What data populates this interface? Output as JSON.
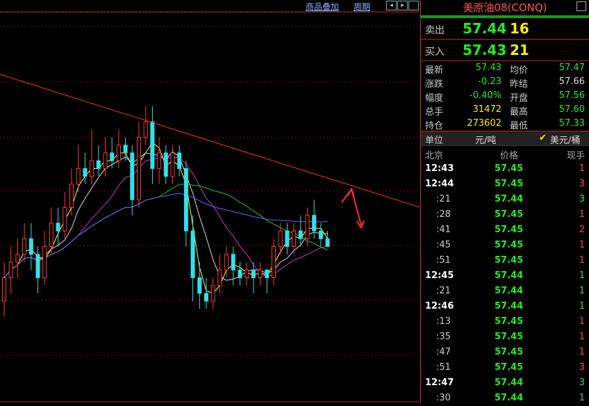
{
  "topbar": {
    "overlay_label": "商品叠加",
    "period_label": "周期",
    "nav_left_icon": "◂",
    "nav_right_icon": "▸"
  },
  "chart_data": {
    "type": "candlestick",
    "title": "",
    "candles": [
      {
        "o": 57.35,
        "c": 57.38,
        "h": 57.4,
        "l": 57.33
      },
      {
        "o": 57.38,
        "c": 57.4,
        "h": 57.42,
        "l": 57.36
      },
      {
        "o": 57.4,
        "c": 57.41,
        "h": 57.43,
        "l": 57.38
      },
      {
        "o": 57.41,
        "c": 57.43,
        "h": 57.45,
        "l": 57.4
      },
      {
        "o": 57.43,
        "c": 57.41,
        "h": 57.45,
        "l": 57.39
      },
      {
        "o": 57.41,
        "c": 57.38,
        "h": 57.42,
        "l": 57.36
      },
      {
        "o": 57.38,
        "c": 57.42,
        "h": 57.44,
        "l": 57.37
      },
      {
        "o": 57.42,
        "c": 57.45,
        "h": 57.47,
        "l": 57.41
      },
      {
        "o": 57.45,
        "c": 57.44,
        "h": 57.47,
        "l": 57.42
      },
      {
        "o": 57.44,
        "c": 57.47,
        "h": 57.49,
        "l": 57.43
      },
      {
        "o": 57.47,
        "c": 57.5,
        "h": 57.52,
        "l": 57.46
      },
      {
        "o": 57.5,
        "c": 57.52,
        "h": 57.55,
        "l": 57.49
      },
      {
        "o": 57.52,
        "c": 57.51,
        "h": 57.54,
        "l": 57.5
      },
      {
        "o": 57.51,
        "c": 57.53,
        "h": 57.57,
        "l": 57.5
      },
      {
        "o": 57.53,
        "c": 57.52,
        "h": 57.55,
        "l": 57.51
      },
      {
        "o": 57.52,
        "c": 57.54,
        "h": 57.56,
        "l": 57.51
      },
      {
        "o": 57.54,
        "c": 57.53,
        "h": 57.56,
        "l": 57.52
      },
      {
        "o": 57.53,
        "c": 57.55,
        "h": 57.57,
        "l": 57.52
      },
      {
        "o": 57.55,
        "c": 57.54,
        "h": 57.56,
        "l": 57.53
      },
      {
        "o": 57.54,
        "c": 57.48,
        "h": 57.55,
        "l": 57.46
      },
      {
        "o": 57.48,
        "c": 57.56,
        "h": 57.58,
        "l": 57.47
      },
      {
        "o": 57.56,
        "c": 57.58,
        "h": 57.6,
        "l": 57.55
      },
      {
        "o": 57.58,
        "c": 57.52,
        "h": 57.6,
        "l": 57.5
      },
      {
        "o": 57.52,
        "c": 57.54,
        "h": 57.56,
        "l": 57.5
      },
      {
        "o": 57.54,
        "c": 57.51,
        "h": 57.55,
        "l": 57.5
      },
      {
        "o": 57.51,
        "c": 57.54,
        "h": 57.55,
        "l": 57.5
      },
      {
        "o": 57.54,
        "c": 57.52,
        "h": 57.55,
        "l": 57.51
      },
      {
        "o": 57.52,
        "c": 57.44,
        "h": 57.53,
        "l": 57.42
      },
      {
        "o": 57.44,
        "c": 57.38,
        "h": 57.46,
        "l": 57.35
      },
      {
        "o": 57.38,
        "c": 57.36,
        "h": 57.4,
        "l": 57.34
      },
      {
        "o": 57.36,
        "c": 57.35,
        "h": 57.38,
        "l": 57.34
      },
      {
        "o": 57.35,
        "c": 57.37,
        "h": 57.38,
        "l": 57.34
      },
      {
        "o": 57.37,
        "c": 57.39,
        "h": 57.41,
        "l": 57.36
      },
      {
        "o": 57.39,
        "c": 57.41,
        "h": 57.42,
        "l": 57.38
      },
      {
        "o": 57.41,
        "c": 57.39,
        "h": 57.42,
        "l": 57.37
      },
      {
        "o": 57.39,
        "c": 57.38,
        "h": 57.4,
        "l": 57.37
      },
      {
        "o": 57.38,
        "c": 57.39,
        "h": 57.4,
        "l": 57.37
      },
      {
        "o": 57.39,
        "c": 57.38,
        "h": 57.4,
        "l": 57.36
      },
      {
        "o": 57.38,
        "c": 57.39,
        "h": 57.4,
        "l": 57.37
      },
      {
        "o": 57.39,
        "c": 57.38,
        "h": 57.39,
        "l": 57.36
      },
      {
        "o": 57.38,
        "c": 57.42,
        "h": 57.43,
        "l": 57.37
      },
      {
        "o": 57.42,
        "c": 57.44,
        "h": 57.45,
        "l": 57.41
      },
      {
        "o": 57.44,
        "c": 57.42,
        "h": 57.45,
        "l": 57.41
      },
      {
        "o": 57.42,
        "c": 57.44,
        "h": 57.45,
        "l": 57.41
      },
      {
        "o": 57.44,
        "c": 57.43,
        "h": 57.46,
        "l": 57.42
      },
      {
        "o": 57.43,
        "c": 57.46,
        "h": 57.47,
        "l": 57.42
      },
      {
        "o": 57.46,
        "c": 57.44,
        "h": 57.48,
        "l": 57.43
      },
      {
        "o": 57.44,
        "c": 57.43,
        "h": 57.45,
        "l": 57.42
      },
      {
        "o": 57.43,
        "c": 57.42,
        "h": 57.44,
        "l": 57.42
      }
    ],
    "ylim": [
      57.22,
      57.72
    ],
    "grid": true
  },
  "panel": {
    "title": "美原油08(CONQ)",
    "sell": {
      "label": "卖出",
      "price": "57.44",
      "volume": "16"
    },
    "buy": {
      "label": "买入",
      "price": "57.43",
      "volume": "21"
    },
    "stats": [
      {
        "k1": "最新",
        "v1": "57.43",
        "c1": "#22ee22",
        "k2": "均价",
        "v2": "57.47",
        "c2": "#22ee22"
      },
      {
        "k1": "涨跌",
        "v1": "-0.23",
        "c1": "#22ee22",
        "k2": "昨结",
        "v2": "57.66",
        "c2": "#dddddd"
      },
      {
        "k1": "幅度",
        "v1": "-0.40%",
        "c1": "#22ee22",
        "k2": "开盘",
        "v2": "57.56",
        "c2": "#22ee22"
      },
      {
        "k1": "总手",
        "v1": "31472",
        "c1": "#ffee00",
        "k2": "最高",
        "v2": "57.60",
        "c2": "#22ee22"
      },
      {
        "k1": "持仓",
        "v1": "273602",
        "c1": "#ffee00",
        "k2": "最低",
        "v2": "57.33",
        "c2": "#22ee22"
      }
    ],
    "unit": {
      "label": "单位",
      "cny": "元/吨",
      "usd": "美元/桶",
      "check_icon": "✔"
    },
    "tick_header": {
      "time": "北京",
      "price": "价格",
      "volume": "现手"
    },
    "ticks": [
      {
        "t": "12:43",
        "big": true,
        "p": "57.45",
        "v": "1",
        "vc": "#ff4444"
      },
      {
        "t": "12:44",
        "big": true,
        "p": "57.45",
        "v": "3",
        "vc": "#ff4444"
      },
      {
        "t": ":21",
        "big": false,
        "p": "57.44",
        "v": "3",
        "vc": "#22ee22"
      },
      {
        "t": ":28",
        "big": false,
        "p": "57.45",
        "v": "1",
        "vc": "#ff4444"
      },
      {
        "t": ":41",
        "big": false,
        "p": "57.45",
        "v": "2",
        "vc": "#ff4444"
      },
      {
        "t": ":45",
        "big": false,
        "p": "57.45",
        "v": "1",
        "vc": "#ff4444"
      },
      {
        "t": ":51",
        "big": false,
        "p": "57.45",
        "v": "1",
        "vc": "#ff4444"
      },
      {
        "t": "12:45",
        "big": true,
        "p": "57.44",
        "v": "1",
        "vc": "#22ee22"
      },
      {
        "t": ":21",
        "big": false,
        "p": "57.44",
        "v": "1",
        "vc": "#22ee22"
      },
      {
        "t": "12:46",
        "big": true,
        "p": "57.44",
        "v": "1",
        "vc": "#22ee22"
      },
      {
        "t": ":13",
        "big": false,
        "p": "57.45",
        "v": "1",
        "vc": "#ff4444"
      },
      {
        "t": ":35",
        "big": false,
        "p": "57.45",
        "v": "1",
        "vc": "#ff4444"
      },
      {
        "t": ":47",
        "big": false,
        "p": "57.45",
        "v": "1",
        "vc": "#ff4444"
      },
      {
        "t": ":51",
        "big": false,
        "p": "57.45",
        "v": "3",
        "vc": "#ff4444"
      },
      {
        "t": "12:47",
        "big": true,
        "p": "57.44",
        "v": "3",
        "vc": "#22ee22"
      },
      {
        "t": ":30",
        "big": false,
        "p": "57.44",
        "v": "1",
        "vc": "#22ee22"
      }
    ]
  }
}
